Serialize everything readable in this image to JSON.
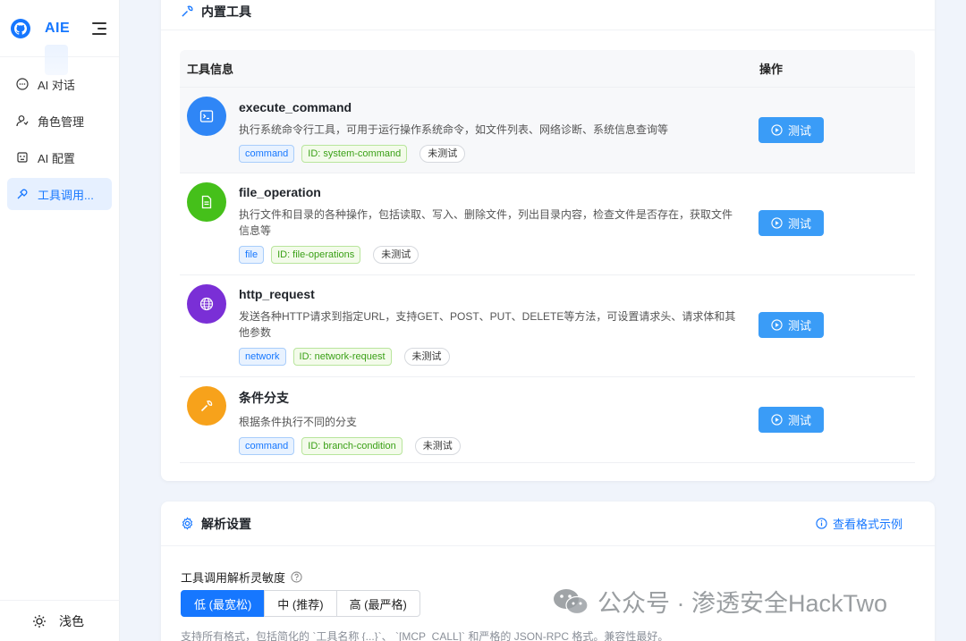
{
  "sidebar": {
    "app_name": "AIE",
    "items": [
      {
        "label": "AI 对话",
        "icon": "chat-icon",
        "active": false
      },
      {
        "label": "角色管理",
        "icon": "user-role-icon",
        "active": false
      },
      {
        "label": "AI 配置",
        "icon": "robot-icon",
        "active": false
      },
      {
        "label": "工具调用...",
        "icon": "tool-link-icon",
        "active": true
      }
    ],
    "theme_label": "浅色"
  },
  "builtin_tools": {
    "title": "内置工具",
    "columns": [
      "工具信息",
      "操作"
    ],
    "test_label": "测试",
    "tools": [
      {
        "name": "execute_command",
        "desc": "执行系统命令行工具，可用于运行操作系统命令，如文件列表、网络诊断、系统信息查询等",
        "category": "command",
        "id_label": "ID: system-command",
        "status": "未测试",
        "icon": "terminal-icon",
        "color": "#2f86f6"
      },
      {
        "name": "file_operation",
        "desc": "执行文件和目录的各种操作，包括读取、写入、删除文件，列出目录内容，检查文件是否存在，获取文件信息等",
        "category": "file",
        "id_label": "ID: file-operations",
        "status": "未测试",
        "icon": "file-icon",
        "color": "#45c01a"
      },
      {
        "name": "http_request",
        "desc": "发送各种HTTP请求到指定URL，支持GET、POST、PUT、DELETE等方法，可设置请求头、请求体和其他参数",
        "category": "network",
        "id_label": "ID: network-request",
        "status": "未测试",
        "icon": "globe-icon",
        "color": "#7a2fd6"
      },
      {
        "name": "条件分支",
        "desc": "根据条件执行不同的分支",
        "category": "command",
        "id_label": "ID: branch-condition",
        "status": "未测试",
        "icon": "wrench-icon",
        "color": "#f7a21b"
      }
    ]
  },
  "parse_settings": {
    "title": "解析设置",
    "example_link": "查看格式示例",
    "sensitivity_label": "工具调用解析灵敏度",
    "options": [
      "低 (最宽松)",
      "中 (推荐)",
      "高 (最严格)"
    ],
    "selected": "低 (最宽松)",
    "help_text": "支持所有格式，包括简化的 `工具名称 {...}`、 `[MCP_CALL]` 和严格的 JSON-RPC 格式。兼容性最好。"
  },
  "watermark": {
    "text": "公众号 · 渗透安全HackTwo"
  }
}
